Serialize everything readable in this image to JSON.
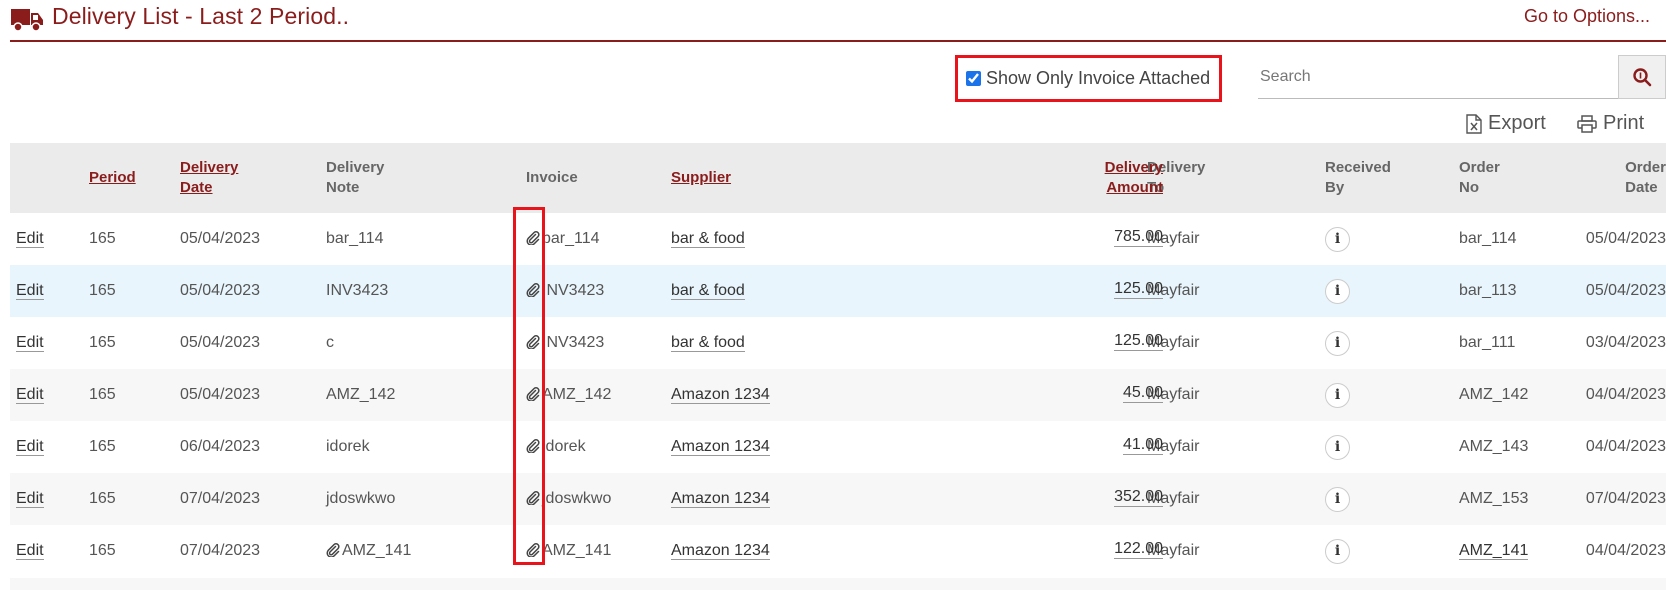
{
  "header": {
    "title": "Delivery List - Last 2 Period..",
    "options_link": "Go to Options..."
  },
  "filter": {
    "checkbox_label": "Show Only Invoice Attached",
    "checked": true
  },
  "search": {
    "placeholder": "Search",
    "value": ""
  },
  "toolbar": {
    "export_label": "Export",
    "print_label": "Print"
  },
  "table": {
    "columns": {
      "period": "Period",
      "delivery_date_1": "Delivery",
      "delivery_date_2": "Date",
      "delivery_note_1": "Delivery",
      "delivery_note_2": "Note",
      "invoice": "Invoice",
      "supplier": "Supplier",
      "delivery_amount_1": "Delivery",
      "delivery_amount_2": "Amount",
      "delivery_to_1": "Delivery",
      "delivery_to_2": "To",
      "received_by_1": "Received",
      "received_by_2": "By",
      "order_no_1": "Order",
      "order_no_2": "No",
      "order_date_1": "Order",
      "order_date_2": "Date"
    },
    "edit_label": "Edit",
    "info_glyph": "i",
    "rows": [
      {
        "period": "165",
        "delivery_date": "05/04/2023",
        "delivery_note": "bar_114",
        "invoice": "bar_114",
        "supplier": "bar & food",
        "amount": "785.00",
        "delivery_to": "Mayfair",
        "order_no": "bar_114",
        "order_date": "05/04/2023"
      },
      {
        "period": "165",
        "delivery_date": "05/04/2023",
        "delivery_note": "INV3423",
        "invoice": "INV3423",
        "supplier": "bar & food",
        "amount": "125.00",
        "delivery_to": "Mayfair",
        "order_no": "bar_113",
        "order_date": "05/04/2023"
      },
      {
        "period": "165",
        "delivery_date": "05/04/2023",
        "delivery_note": "c",
        "invoice": "INV3423",
        "supplier": "bar & food",
        "amount": "125.00",
        "delivery_to": "Mayfair",
        "order_no": "bar_111",
        "order_date": "03/04/2023"
      },
      {
        "period": "165",
        "delivery_date": "05/04/2023",
        "delivery_note": "AMZ_142",
        "invoice": "AMZ_142",
        "supplier": "Amazon 1234",
        "amount": "45.00",
        "delivery_to": "Mayfair",
        "order_no": "AMZ_142",
        "order_date": "04/04/2023"
      },
      {
        "period": "165",
        "delivery_date": "06/04/2023",
        "delivery_note": "idorek",
        "invoice": "idorek",
        "supplier": "Amazon 1234",
        "amount": "41.00",
        "delivery_to": "Mayfair",
        "order_no": "AMZ_143",
        "order_date": "04/04/2023"
      },
      {
        "period": "165",
        "delivery_date": "07/04/2023",
        "delivery_note": "jdoswkwo",
        "invoice": "jdoswkwo",
        "supplier": "Amazon 1234",
        "amount": "352.00",
        "delivery_to": "Mayfair",
        "order_no": "AMZ_153",
        "order_date": "07/04/2023"
      },
      {
        "period": "165",
        "delivery_date": "07/04/2023",
        "delivery_note": "AMZ_141",
        "invoice": "AMZ_141",
        "supplier": "Amazon 1234",
        "amount": "122.00",
        "delivery_to": "Mayfair",
        "order_no": "AMZ_141",
        "order_date": "04/04/2023"
      }
    ]
  },
  "icons": {
    "truck": "truck-icon",
    "search": "search-icon",
    "export": "excel-export-icon",
    "print": "printer-icon",
    "attachment": "paperclip-icon",
    "info": "info-icon"
  },
  "colors": {
    "brand": "#8b1c1c",
    "highlight_box": "#e8131b",
    "header_bg": "#ebebeb",
    "selected_row": "#e8f5fc"
  }
}
